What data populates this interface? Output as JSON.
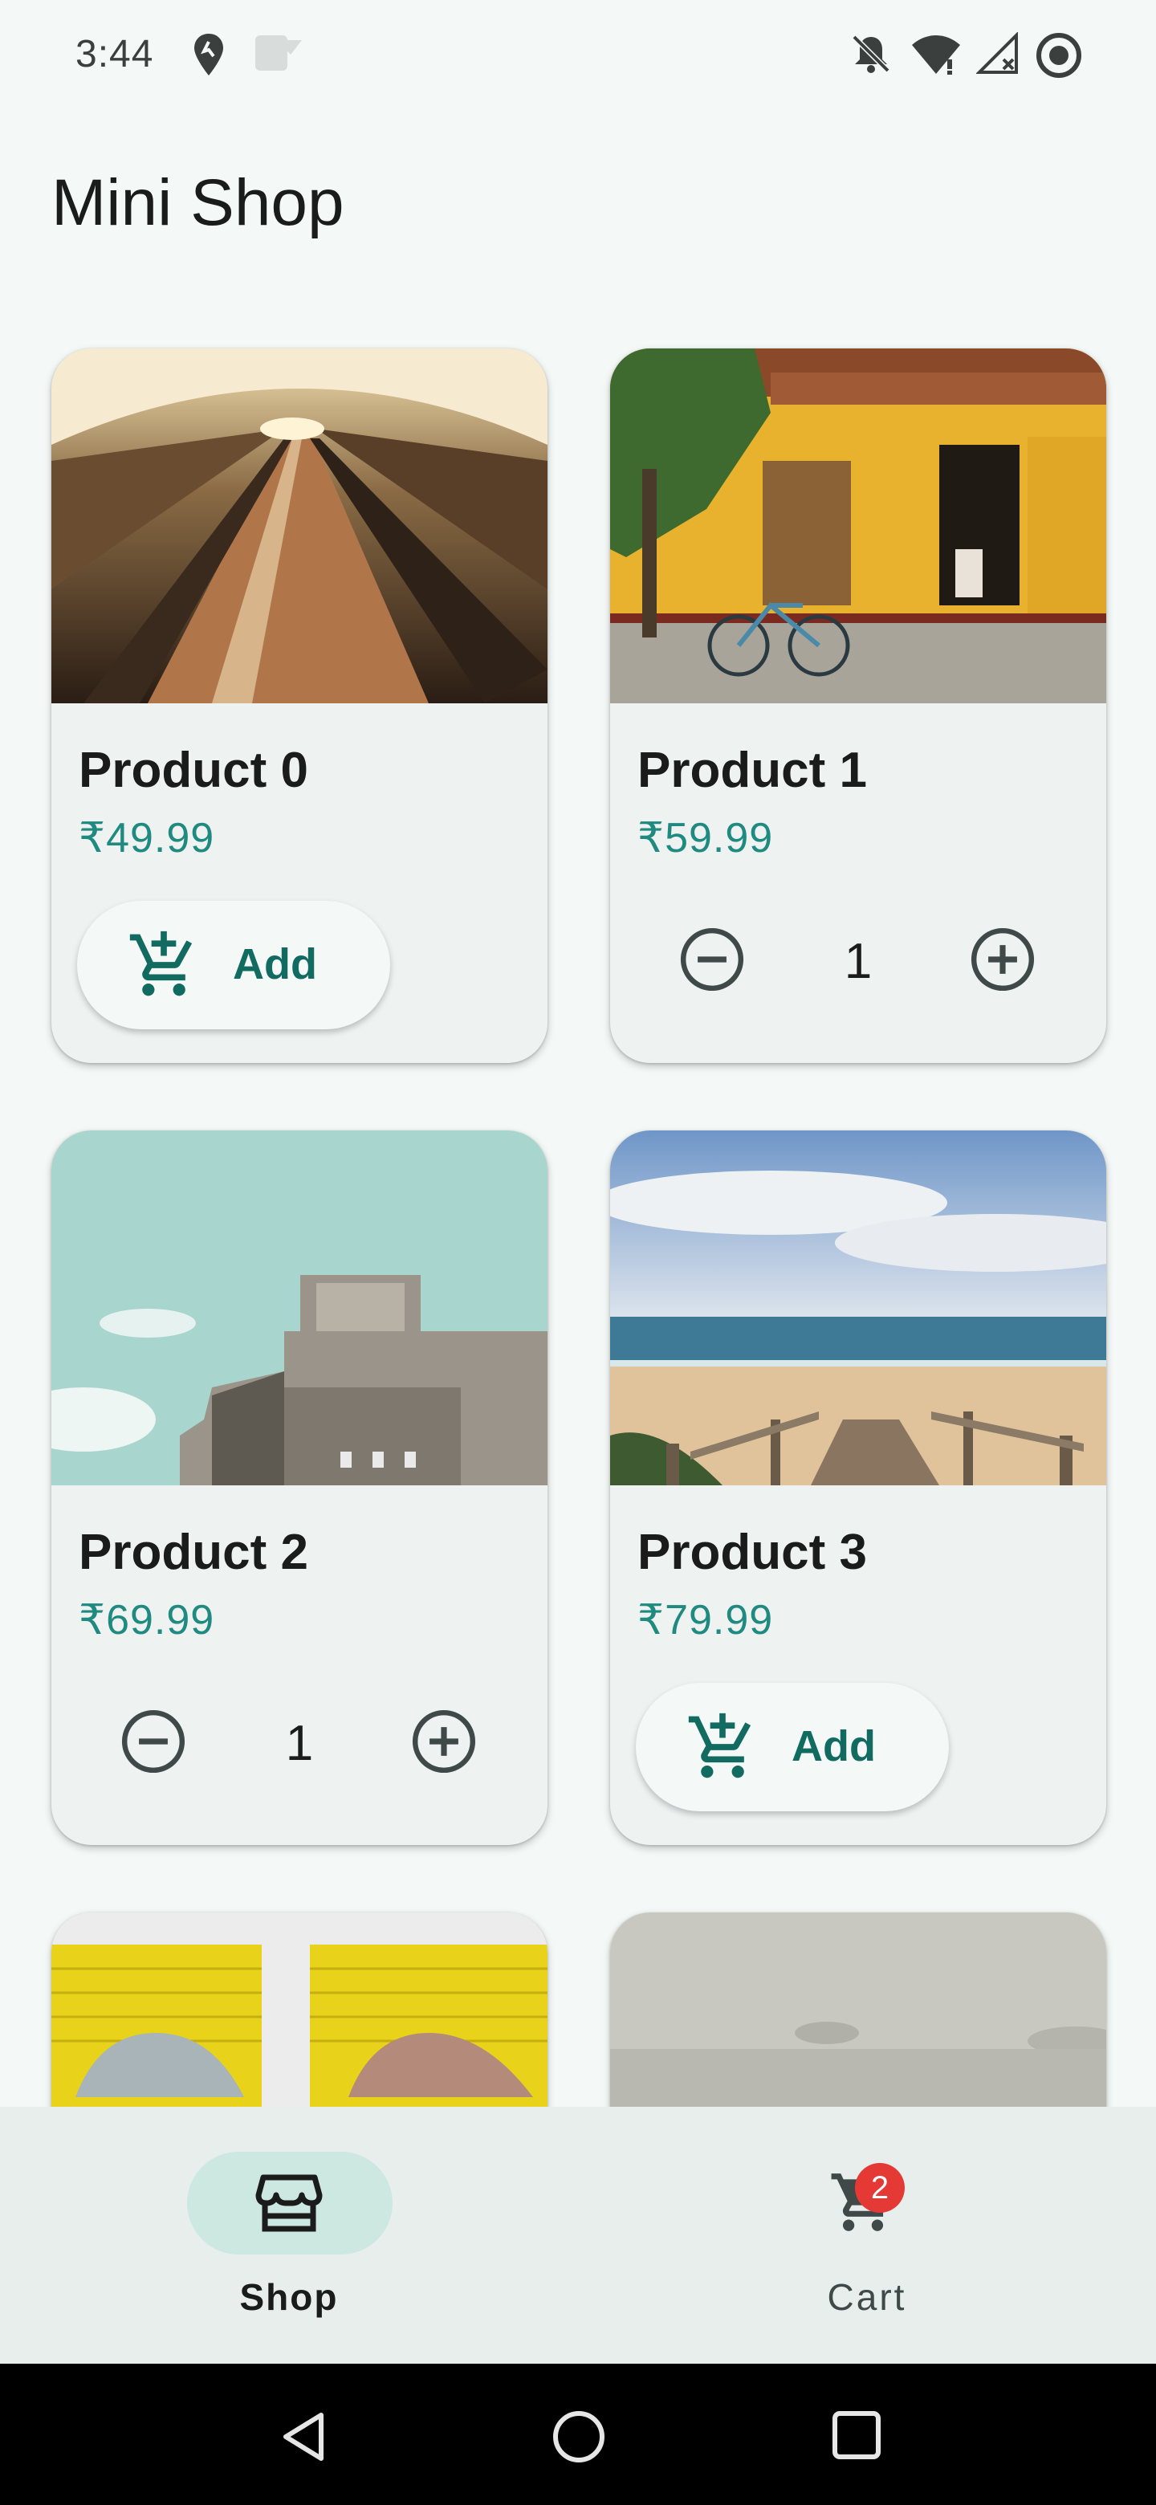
{
  "status_bar": {
    "time": "3:44",
    "left_icons": [
      "location-pin-icon",
      "notification-app-icon"
    ],
    "right_icons": [
      "bell-off-icon",
      "wifi-icon",
      "signal-off-icon",
      "sync-icon"
    ]
  },
  "header": {
    "title": "Mini Shop"
  },
  "products": [
    {
      "name": "Product 0",
      "price": "₹49.99",
      "quantity": 0,
      "add_label": "Add",
      "image": "escalator-tunnel-photo"
    },
    {
      "name": "Product 1",
      "price": "₹59.99",
      "quantity": "1",
      "image": "yellow-house-bicycle-photo"
    },
    {
      "name": "Product 2",
      "price": "₹69.99",
      "quantity": "1",
      "image": "concrete-bunker-photo"
    },
    {
      "name": "Product 3",
      "price": "₹79.99",
      "quantity": 0,
      "add_label": "Add",
      "image": "beach-boardwalk-photo"
    },
    {
      "image": "yellow-garage-cars-photo"
    },
    {
      "image": "foggy-landscape-photo"
    }
  ],
  "bottom_nav": {
    "shop_label": "Shop",
    "cart_label": "Cart",
    "cart_badge": "2",
    "selected": "Shop"
  },
  "colors": {
    "background": "#f4f9f7",
    "price": "#1e8a80",
    "accent": "#126b61",
    "selected_pill": "#cce8e1",
    "badge": "#e53935"
  }
}
